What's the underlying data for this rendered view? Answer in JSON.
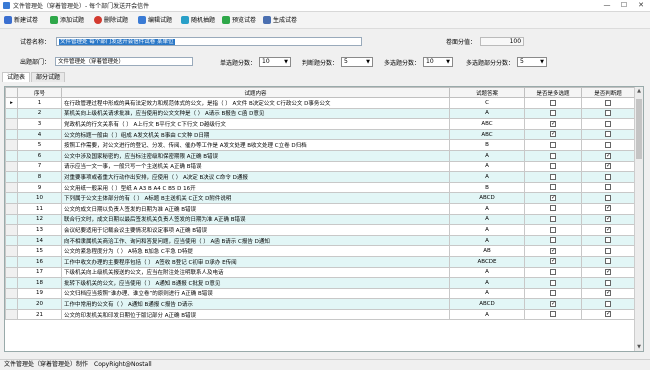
{
  "window": {
    "title": "文件管理处（穿着管理处）- 每个部门发送开会信件",
    "minimize": "—",
    "maximize": "☐",
    "close": "✕"
  },
  "toolbar": [
    {
      "label": "新建试卷",
      "icon": "new-icon",
      "color": "#3b6fd0"
    },
    {
      "label": "添加试题",
      "icon": "add-icon",
      "color": "#2fa84a"
    },
    {
      "label": "删除试题",
      "icon": "delete-icon",
      "color": "#d33a2f"
    },
    {
      "label": "编辑试题",
      "icon": "edit-icon",
      "color": "#3a7bd5"
    },
    {
      "label": "随机抽题",
      "icon": "random-icon",
      "color": "#29a0c8"
    },
    {
      "label": "预览试卷",
      "icon": "preview-icon",
      "color": "#2fa84a"
    },
    {
      "label": "生成试卷",
      "icon": "generate-icon",
      "color": "#4a6fb0"
    }
  ],
  "form": {
    "exam_name_label": "试卷名称：",
    "exam_name_value": "文件管理处 每个部门发送开会信件试卷 某单位",
    "total_score_label": "卷面分值：",
    "total_score_value": "100",
    "publisher_label": "出题部门：",
    "publisher_value": "文件管理处（穿着管理处）",
    "single_score_label": "单选题分数：",
    "single_score_value": "10",
    "judge_score_label": "判断题分数：",
    "judge_score_value": "5",
    "multi_score_label": "多选题分数：",
    "multi_score_value": "10",
    "multi_partial_label": "多选题部分分数：",
    "multi_partial_value": "5"
  },
  "tabs": [
    {
      "label": "试题表"
    },
    {
      "label": "部分试题"
    }
  ],
  "grid": {
    "columns": [
      "序号",
      "试题内容",
      "试题答案",
      "是否是多选题",
      "是否判断题"
    ],
    "rows": [
      {
        "no": "1",
        "content": "在行政管理过程中形成的具有法定效力和规范体式的公文，是指（ ）  A文件  B决定公文  C行政公文  D事务公文",
        "answer": "C",
        "multi": false,
        "judge": false
      },
      {
        "no": "2",
        "content": "某机关向上级机关请求批准，应当使用的公文文种是（ ）  A请示  B报告  C函  D意见",
        "answer": "A",
        "multi": false,
        "judge": false
      },
      {
        "no": "3",
        "content": "党政机关的行文关系有（ ）  A上行文  B平行文  C下行文  D越级行文",
        "answer": "ABC",
        "multi": true,
        "judge": false
      },
      {
        "no": "4",
        "content": "公文的标题一般由（ ）组成  A发文机关  B事由  C文种  D日期",
        "answer": "ABC",
        "multi": true,
        "judge": false
      },
      {
        "no": "5",
        "content": "按照工作需要，对公文进行的登记、分发、传阅、催办等工作是  A发文处理  B收文处理  C立卷  D归档",
        "answer": "B",
        "multi": false,
        "judge": false
      },
      {
        "no": "6",
        "content": "公文中涉及国家秘密的，应当标注密级和保密期限  A正确  B错误",
        "answer": "A",
        "multi": false,
        "judge": true
      },
      {
        "no": "7",
        "content": "请示应当一文一事，一般只写一个主送机关  A正确  B错误",
        "answer": "A",
        "multi": false,
        "judge": true
      },
      {
        "no": "8",
        "content": "对重要事项或者重大行动作出安排，应使用（ ）  A决定  B决议  C命令  D通报",
        "answer": "A",
        "multi": false,
        "judge": false
      },
      {
        "no": "9",
        "content": "公文用纸一般采用（ ）型纸  A A3  B A4  C B5  D 16开",
        "answer": "B",
        "multi": false,
        "judge": false
      },
      {
        "no": "10",
        "content": "下列属于公文主体部分的有（ ）  A标题  B主送机关  C正文  D附件说明",
        "answer": "ABCD",
        "multi": true,
        "judge": false
      },
      {
        "no": "11",
        "content": "公文的成文日期以负责人签发的日期为准  A正确  B错误",
        "answer": "A",
        "multi": false,
        "judge": true
      },
      {
        "no": "12",
        "content": "联合行文时，成文日期以最后签发机关负责人签发的日期为准  A正确  B错误",
        "answer": "A",
        "multi": false,
        "judge": true
      },
      {
        "no": "13",
        "content": "会议纪要适用于记载会议主要情况和议定事项  A正确  B错误",
        "answer": "A",
        "multi": false,
        "judge": true
      },
      {
        "no": "14",
        "content": "向不相隶属机关商洽工作、询问和答复问题，应当使用（ ）  A函  B请示  C报告  D通知",
        "answer": "A",
        "multi": false,
        "judge": false
      },
      {
        "no": "15",
        "content": "公文的紧急程度分为（ ）  A特急  B加急  C平急  D特提",
        "answer": "AB",
        "multi": true,
        "judge": false
      },
      {
        "no": "16",
        "content": "工作中收文办理的主要程序包括（ ）  A签收  B登记  C初审  D承办  E传阅",
        "answer": "ABCDE",
        "multi": true,
        "judge": false
      },
      {
        "no": "17",
        "content": "下级机关向上级机关报送的公文，应当在附注处注明联系人及电话",
        "answer": "A",
        "multi": false,
        "judge": true
      },
      {
        "no": "18",
        "content": "批转下级机关的公文，应当使用（ ）  A通知  B通报  C批复  D意见",
        "answer": "A",
        "multi": false,
        "judge": false
      },
      {
        "no": "19",
        "content": "公文归档应当按照“谁办理、谁立卷”的原则进行  A正确  B错误",
        "answer": "A",
        "multi": false,
        "judge": true
      },
      {
        "no": "20",
        "content": "工作中常用的公文有（ ）  A通知  B通报  C报告  D请示",
        "answer": "ABCD",
        "multi": true,
        "judge": false
      },
      {
        "no": "21",
        "content": "公文的印发机关和印发日期位于版记部分  A正确  B错误",
        "answer": "A",
        "multi": false,
        "judge": true
      }
    ]
  },
  "status": {
    "company": "文件管理处（穿着管理处）制作",
    "copyright": "CopyRight@Nostall"
  },
  "colors": {
    "selection": "#2a78c8",
    "alt_row": "#e2f6f6"
  }
}
